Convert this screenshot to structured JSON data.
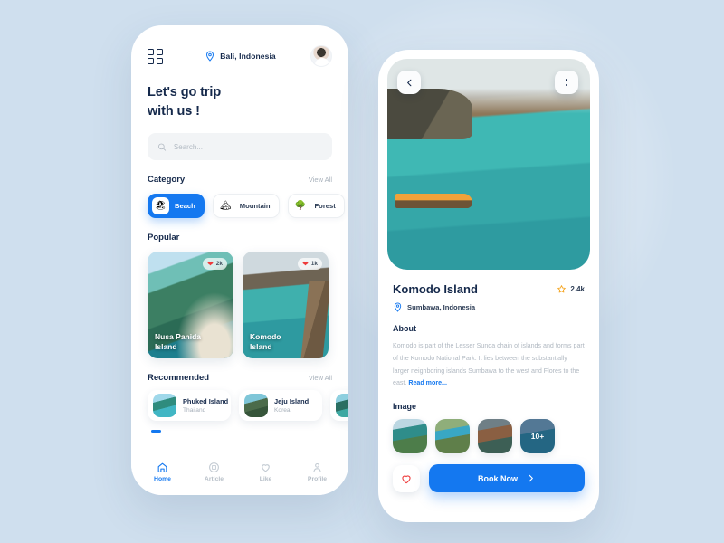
{
  "home": {
    "menu_icon": "grid-menu-icon",
    "location": "Bali, Indonesia",
    "location_icon": "location-pin-icon",
    "avatar": "user-avatar",
    "headline_line1": "Let's go trip",
    "headline_line2": "with us !",
    "search": {
      "placeholder": "Search...",
      "value": "",
      "icon": "search-icon"
    },
    "category": {
      "title": "Category",
      "view_all": "View All",
      "chips": [
        {
          "label": "Beach",
          "icon": "beach-icon",
          "glyph": "🏖",
          "active": true
        },
        {
          "label": "Mountain",
          "icon": "mountain-icon",
          "glyph": "🏔",
          "active": false
        },
        {
          "label": "Forest",
          "icon": "forest-icon",
          "glyph": "🌳",
          "active": false
        }
      ]
    },
    "popular": {
      "title": "Popular",
      "cards": [
        {
          "name_line1": "Nusa Panida",
          "name_line2": "Island",
          "likes": "2k"
        },
        {
          "name_line1": "Komodo",
          "name_line2": "Island",
          "likes": "1k"
        }
      ]
    },
    "recommended": {
      "title": "Recommended",
      "view_all": "View All",
      "cards": [
        {
          "name": "Phuked Island",
          "country": "Thailand"
        },
        {
          "name": "Jeju Island",
          "country": "Korea"
        }
      ]
    },
    "tabs": [
      {
        "label": "Home",
        "icon": "home-icon",
        "active": true
      },
      {
        "label": "Article",
        "icon": "article-icon",
        "active": false
      },
      {
        "label": "Like",
        "icon": "heart-icon",
        "active": false
      },
      {
        "label": "Profile",
        "icon": "person-icon",
        "active": false
      }
    ]
  },
  "detail": {
    "back_icon": "chevron-left-icon",
    "more_icon": "more-vertical-icon",
    "title": "Komodo Island",
    "rating": "2.4k",
    "rating_icon": "star-icon",
    "location": "Sumbawa, Indonesia",
    "location_icon": "location-pin-icon",
    "about_title": "About",
    "about_text": "Komodo is part of the Lesser Sunda chain of islands and forms part of the Komodo National Park. It lies between the substantially larger neighboring islands Sumbawa to the west and Flores to the east. ",
    "read_more": "Read more...",
    "image_title": "Image",
    "image_more_count": "10+",
    "favorite_icon": "heart-outline-icon",
    "book_label": "Book Now",
    "book_arrow_icon": "chevron-right-icon"
  },
  "colors": {
    "background": "#cfdfee",
    "accent_blue": "#1478f0",
    "navy_text": "#15294b",
    "muted_text": "#b0b8c1",
    "heart_red": "#ee3b3b",
    "star_orange": "#f5a623"
  }
}
